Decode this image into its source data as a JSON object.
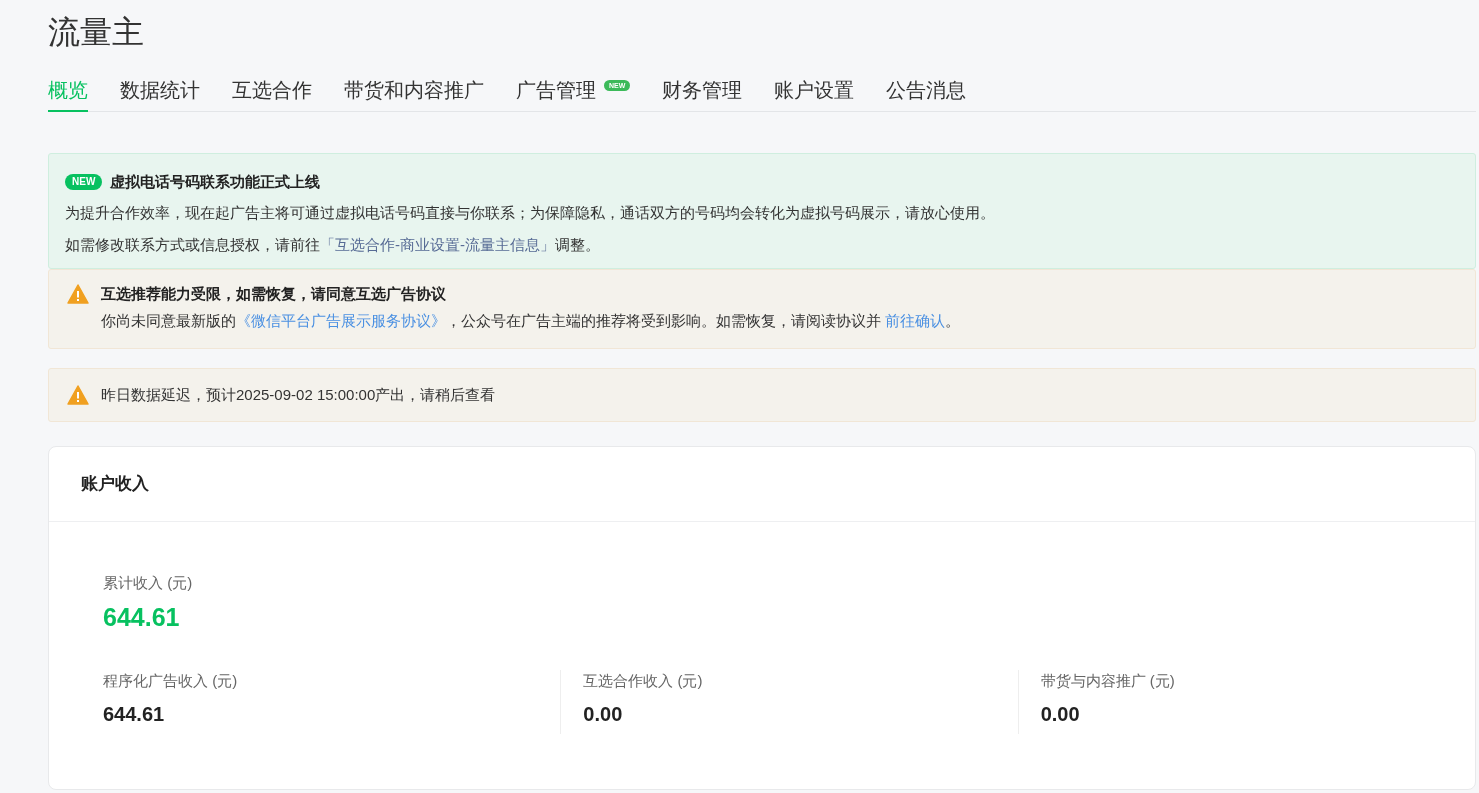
{
  "page_title": "流量主",
  "tabs": [
    {
      "label": "概览",
      "selected": true
    },
    {
      "label": "数据统计",
      "selected": false
    },
    {
      "label": "互选合作",
      "selected": false
    },
    {
      "label": "带货和内容推广",
      "selected": false
    },
    {
      "label": "广告管理",
      "selected": false,
      "badge": "NEW"
    },
    {
      "label": "财务管理",
      "selected": false
    },
    {
      "label": "账户设置",
      "selected": false
    },
    {
      "label": "公告消息",
      "selected": false
    }
  ],
  "notices": [
    {
      "kind": "announcement",
      "badge": "NEW",
      "title": "虚拟电话号码联系功能正式上线",
      "lines": [
        [
          {
            "text": "为提升合作效率，现在起广告主将可通过虚拟电话号码直接与你联系；为保障隐私，通话双方的号码均会转化为虚拟号码展示，请放心使用。"
          }
        ],
        [
          {
            "text": "如需修改联系方式或信息授权，请前往"
          },
          {
            "link": "「互选合作-商业设置-流量主信息」"
          },
          {
            "text": "调整。"
          }
        ]
      ]
    },
    {
      "kind": "warning",
      "title": "互选推荐能力受限，如需恢复，请同意互选广告协议",
      "lines": [
        [
          {
            "text": "你尚未同意最新版的"
          },
          {
            "link": "《微信平台广告展示服务协议》"
          },
          {
            "text": "，公众号在广告主端的推荐将受到影响。如需恢复，请阅读协议并 "
          },
          {
            "link": "前往确认"
          },
          {
            "text": "。"
          }
        ]
      ]
    },
    {
      "kind": "warning",
      "lines": [
        [
          {
            "text": "昨日数据延迟，预计2025-09-02 15:00:00产出，请稍后查看"
          }
        ]
      ]
    }
  ],
  "income": {
    "title": "账户收入",
    "total": {
      "label": "累计收入 (元)",
      "value": "644.61"
    },
    "items": [
      {
        "label": "程序化广告收入 (元)",
        "value": "644.61"
      },
      {
        "label": "互选合作收入 (元)",
        "value": "0.00"
      },
      {
        "label": "带货与内容推广 (元)",
        "value": "0.00"
      }
    ]
  }
}
